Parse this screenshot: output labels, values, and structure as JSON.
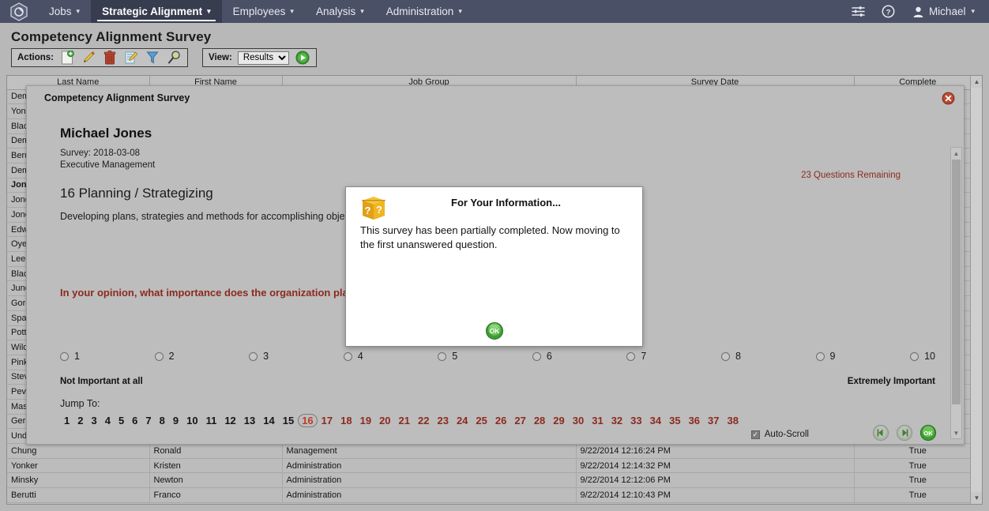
{
  "topnav": {
    "logo_icon": "hexagon-logo-icon",
    "items": [
      {
        "label": "Jobs",
        "active": false,
        "has_caret": true
      },
      {
        "label": "Strategic Alignment",
        "active": true,
        "has_caret": true
      },
      {
        "label": "Employees",
        "active": false,
        "has_caret": true
      },
      {
        "label": "Analysis",
        "active": false,
        "has_caret": true
      },
      {
        "label": "Administration",
        "active": false,
        "has_caret": true
      }
    ],
    "settings_icon": "sliders-icon",
    "help_icon": "help-circle-icon",
    "user_icon": "user-avatar-icon",
    "user_label": "Michael",
    "bar_color": "#4a5066",
    "active_color": "#373c4e"
  },
  "page": {
    "title": "Competency Alignment Survey"
  },
  "toolbar": {
    "actions_label": "Actions:",
    "action_icons": [
      "new-document-icon",
      "edit-pencil-icon",
      "delete-trash-icon",
      "edit-notes-icon",
      "filter-funnel-icon",
      "search-magnifier-icon"
    ],
    "view_label": "View:",
    "view_value": "Results",
    "view_options": [
      "Results"
    ],
    "run_icon": "play-run-icon"
  },
  "grid": {
    "columns": [
      "Last Name",
      "First Name",
      "Job Group",
      "Survey Date",
      "Complete"
    ],
    "rows": [
      {
        "last": "Demeter",
        "first": "",
        "group": "",
        "date": "",
        "complete": "",
        "selected": false
      },
      {
        "last": "Yonker",
        "first": "",
        "group": "",
        "date": "",
        "complete": "",
        "selected": false
      },
      {
        "last": "Black",
        "first": "",
        "group": "",
        "date": "",
        "complete": "",
        "selected": false
      },
      {
        "last": "Demers",
        "first": "",
        "group": "",
        "date": "",
        "complete": "",
        "selected": false
      },
      {
        "last": "Berutti",
        "first": "",
        "group": "",
        "date": "",
        "complete": "",
        "selected": false
      },
      {
        "last": "Demsky",
        "first": "",
        "group": "",
        "date": "",
        "complete": "",
        "selected": false
      },
      {
        "last": "Jones",
        "first": "",
        "group": "",
        "date": "",
        "complete": "",
        "selected": true
      },
      {
        "last": "Jones",
        "first": "",
        "group": "",
        "date": "",
        "complete": "",
        "selected": false
      },
      {
        "last": "Jones",
        "first": "",
        "group": "",
        "date": "",
        "complete": "",
        "selected": false
      },
      {
        "last": "Edwards",
        "first": "",
        "group": "",
        "date": "",
        "complete": "",
        "selected": false
      },
      {
        "last": "Oyelaran",
        "first": "",
        "group": "",
        "date": "",
        "complete": "",
        "selected": false
      },
      {
        "last": "Lee",
        "first": "",
        "group": "",
        "date": "",
        "complete": "",
        "selected": false
      },
      {
        "last": "Black",
        "first": "",
        "group": "",
        "date": "",
        "complete": "",
        "selected": false
      },
      {
        "last": "Junca",
        "first": "",
        "group": "",
        "date": "",
        "complete": "",
        "selected": false
      },
      {
        "last": "Gordon",
        "first": "",
        "group": "",
        "date": "",
        "complete": "",
        "selected": false
      },
      {
        "last": "Spax",
        "first": "",
        "group": "",
        "date": "",
        "complete": "",
        "selected": false
      },
      {
        "last": "Potter",
        "first": "",
        "group": "",
        "date": "",
        "complete": "",
        "selected": false
      },
      {
        "last": "Wilder",
        "first": "",
        "group": "",
        "date": "",
        "complete": "",
        "selected": false
      },
      {
        "last": "Pinkus",
        "first": "",
        "group": "",
        "date": "",
        "complete": "",
        "selected": false
      },
      {
        "last": "Stevens",
        "first": "",
        "group": "",
        "date": "",
        "complete": "",
        "selected": false
      },
      {
        "last": "Pevar",
        "first": "",
        "group": "",
        "date": "",
        "complete": "",
        "selected": false
      },
      {
        "last": "Mason",
        "first": "",
        "group": "",
        "date": "",
        "complete": "",
        "selected": false
      },
      {
        "last": "Gerrity",
        "first": "",
        "group": "",
        "date": "",
        "complete": "",
        "selected": false
      },
      {
        "last": "Underhill",
        "first": "",
        "group": "",
        "date": "",
        "complete": "",
        "selected": false
      },
      {
        "last": "Chung",
        "first": "Ronald",
        "group": "Management",
        "date": "9/22/2014 12:16:24 PM",
        "complete": "True",
        "selected": false
      },
      {
        "last": "Yonker",
        "first": "Kristen",
        "group": "Administration",
        "date": "9/22/2014 12:14:32 PM",
        "complete": "True",
        "selected": false
      },
      {
        "last": "Minsky",
        "first": "Newton",
        "group": "Administration",
        "date": "9/22/2014 12:12:06 PM",
        "complete": "True",
        "selected": false
      },
      {
        "last": "Berutti",
        "first": "Franco",
        "group": "Administration",
        "date": "9/22/2014 12:10:43 PM",
        "complete": "True",
        "selected": false
      }
    ]
  },
  "modal": {
    "title": "Competency Alignment Survey",
    "close_icon": "close-circle-icon",
    "respondent": "Michael Jones",
    "survey_date_line": "Survey: 2018-03-08",
    "job_group_line": "Executive Management",
    "questions_remaining": "23 Questions Remaining",
    "competency_title": "16 Planning / Strategizing",
    "competency_description": "Developing plans, strategies and methods for accomplishing objectives.",
    "question_prompt": "In your opinion, what importance does the organization place on this competency?",
    "scale": {
      "options": [
        "1",
        "2",
        "3",
        "4",
        "5",
        "6",
        "7",
        "8",
        "9",
        "10"
      ],
      "low_anchor": "Not Important at all",
      "high_anchor": "Extremely Important",
      "selected": null
    },
    "jump": {
      "label": "Jump To:",
      "numbers": [
        "1",
        "2",
        "3",
        "4",
        "5",
        "6",
        "7",
        "8",
        "9",
        "10",
        "11",
        "12",
        "13",
        "14",
        "15",
        "16",
        "17",
        "18",
        "19",
        "20",
        "21",
        "22",
        "23",
        "24",
        "25",
        "26",
        "27",
        "28",
        "29",
        "30",
        "31",
        "32",
        "33",
        "34",
        "35",
        "36",
        "37",
        "38"
      ],
      "current": "16",
      "answered_through": 15,
      "answered_color": "#141414",
      "unanswered_color": "#8c2a1e"
    },
    "autoscroll_label": "Auto-Scroll",
    "autoscroll_checked": true,
    "footer_icons": [
      "previous-question-icon",
      "next-question-icon",
      "submit-ok-icon"
    ]
  },
  "fyi_dialog": {
    "icon": "information-question-box-icon",
    "title": "For Your Information...",
    "message": "This survey has been partially completed. Now moving to the first unanswered question.",
    "ok_icon": "ok-button-icon",
    "ok_label": "OK"
  }
}
